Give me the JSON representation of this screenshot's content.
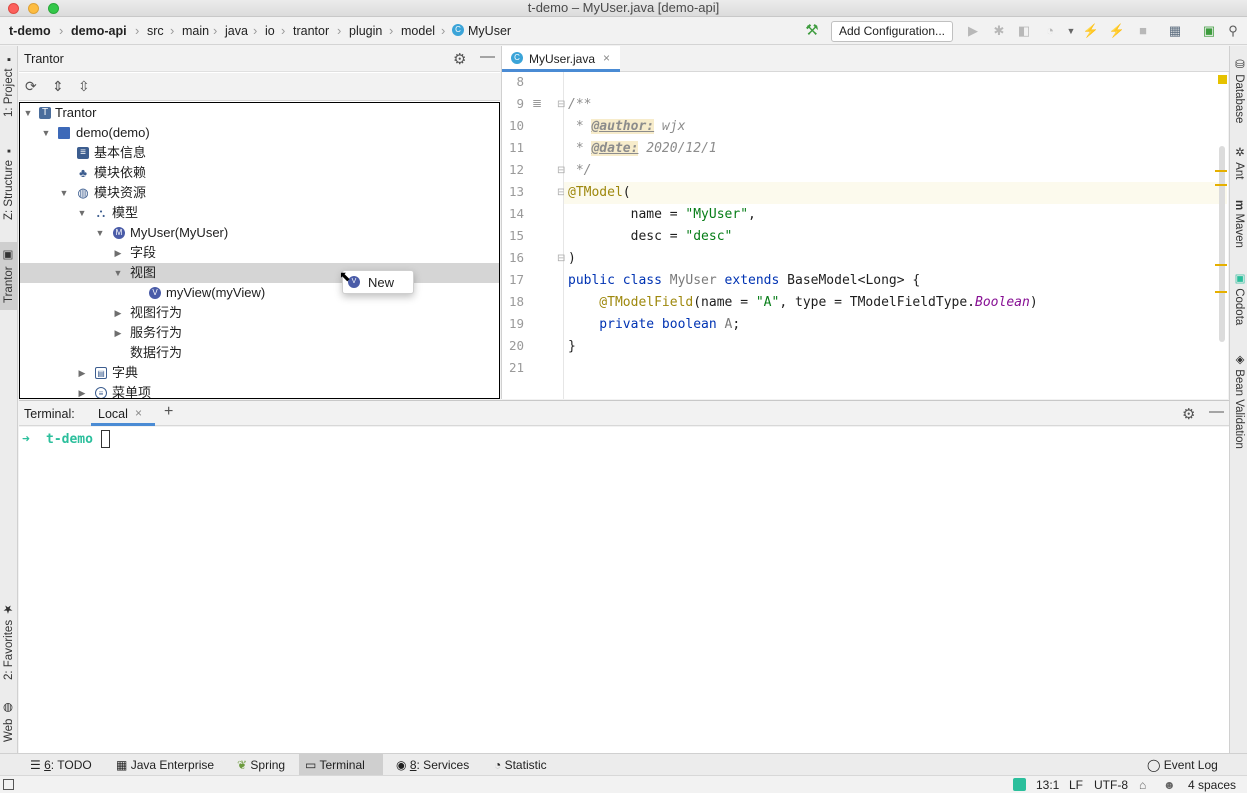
{
  "window": {
    "title": "t-demo – MyUser.java [demo-api]"
  },
  "breadcrumbs": [
    "t-demo",
    "demo-api",
    "src",
    "main",
    "java",
    "io",
    "trantor",
    "plugin",
    "model",
    "MyUser"
  ],
  "toolbar": {
    "add_configuration": "Add Configuration..."
  },
  "left_strip": {
    "project": "1: Project",
    "structure": "Z: Structure",
    "trantor": "Trantor",
    "favorites": "2: Favorites",
    "web": "Web"
  },
  "right_strip": {
    "database": "Database",
    "ant": "Ant",
    "maven": "Maven",
    "codota": "Codota",
    "bean_validation": "Bean Validation"
  },
  "panel": {
    "title": "Trantor",
    "tree": [
      {
        "label": "Trantor"
      },
      {
        "label": "demo(demo)"
      },
      {
        "label": "基本信息"
      },
      {
        "label": "模块依赖"
      },
      {
        "label": "模块资源"
      },
      {
        "label": "模型"
      },
      {
        "label": "MyUser(MyUser)"
      },
      {
        "label": "字段"
      },
      {
        "label": "视图"
      },
      {
        "label": "myView(myView)"
      },
      {
        "label": "视图行为"
      },
      {
        "label": "服务行为"
      },
      {
        "label": "数据行为"
      },
      {
        "label": "字典"
      },
      {
        "label": "菜单项"
      }
    ],
    "popup_label": "New"
  },
  "editor": {
    "tab_label": "MyUser.java",
    "line_numbers": [
      "8",
      "9",
      "10",
      "11",
      "12",
      "13",
      "14",
      "15",
      "16",
      "17",
      "18",
      "19",
      "20",
      "21"
    ],
    "code": {
      "l9": "/**",
      "l10_star": " * ",
      "l10_tag": "@author:",
      "l10_val": " wjx",
      "l11_star": " * ",
      "l11_tag": "@date:",
      "l11_val": " 2020/12/1",
      "l12": " */",
      "l13_ann": "@TModel",
      "l13_rest": "(",
      "l14_a": "        name = ",
      "l14_b": "\"MyUser\"",
      "l14_c": ",",
      "l15_a": "        desc = ",
      "l15_b": "\"desc\"",
      "l16": ")",
      "l17_kw1": "public class ",
      "l17_name": "MyUser",
      "l17_kw2": " extends ",
      "l17_rest": "BaseModel<Long> {",
      "l18_ann": "    @TModelField",
      "l18_a": "(name = ",
      "l18_b": "\"A\"",
      "l18_c": ", type = TModelFieldType.",
      "l18_d": "Boolean",
      "l18_e": ")",
      "l19_kw": "    private boolean ",
      "l19_name": "A",
      "l19_end": ";",
      "l20": "}"
    }
  },
  "terminal": {
    "label": "Terminal:",
    "tab": "Local",
    "prompt_arrow": "➜",
    "prompt_dir": "t-demo"
  },
  "bottom_tabs": {
    "todo_num": "6",
    "todo_text": ": TODO",
    "java_enterprise": "Java Enterprise",
    "spring": "Spring",
    "terminal": "Terminal",
    "services_num": "8",
    "services_text": ": Services",
    "statistic": "Statistic",
    "event_log": "Event Log"
  },
  "status": {
    "position": "13:1",
    "line_sep": "LF",
    "encoding": "UTF-8",
    "indent": "4 spaces"
  },
  "colors": {
    "accent": "#4a8bd4",
    "terminal_prompt": "#2bbf9c",
    "marker": "#e6b000"
  }
}
